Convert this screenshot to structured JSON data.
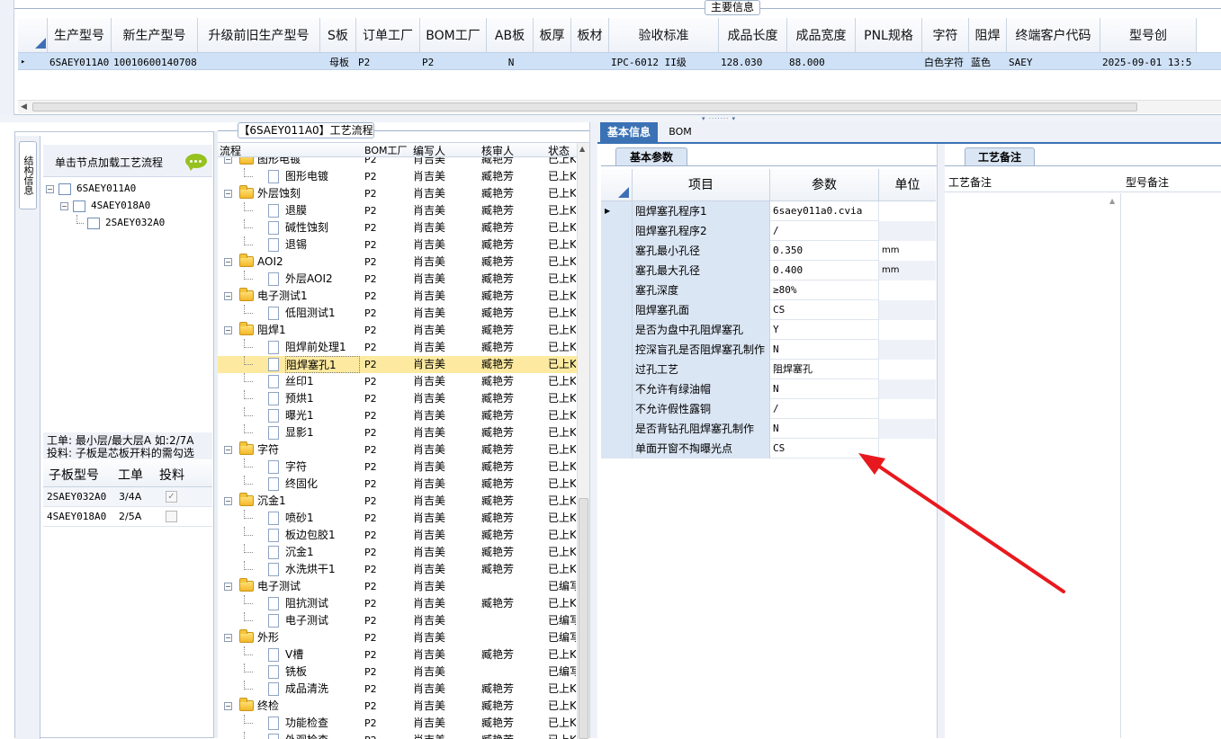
{
  "main_info": {
    "title": "主要信息",
    "columns": [
      "生产型号",
      "新生产型号",
      "升级前旧生产型号",
      "S板",
      "订单工厂",
      "BOM工厂",
      "AB板",
      "板厚",
      "板材",
      "验收标准",
      "成品长度",
      "成品宽度",
      "PNL规格",
      "字符",
      "阻焊",
      "终端客户代码",
      "型号创"
    ],
    "row": {
      "marker": "▸",
      "cells": [
        "6SAEY011A0",
        "10010600140708",
        "",
        "母板",
        "P2",
        "P2",
        "N",
        "",
        "",
        "IPC-6012 II级",
        "128.030",
        "88.000",
        "",
        "白色字符",
        "蓝色",
        "SAEY",
        "2025-09-01 13:5"
      ]
    }
  },
  "left_panel": {
    "vertical_tab": "结构信息",
    "hint": "单击节点加载工艺流程",
    "tree": [
      {
        "label": "6SAEY011A0",
        "depth": 0
      },
      {
        "label": "4SAEY018A0",
        "depth": 1
      },
      {
        "label": "2SAEY032A0",
        "depth": 2
      }
    ],
    "note1": "工单: 最小层/最大层A 如:2/7A",
    "note2": "投料: 子板是芯板开料的需勾选",
    "sub_table": {
      "headers": [
        "子板型号",
        "工单",
        "投料"
      ],
      "rows": [
        {
          "model": "2SAEY032A0",
          "order": "3/4A",
          "checked": true
        },
        {
          "model": "4SAEY018A0",
          "order": "2/5A",
          "checked": false
        }
      ]
    }
  },
  "process": {
    "title": "【6SAEY011A0】工艺流程",
    "headers": [
      "流程",
      "BOM工厂",
      "编写人",
      "核审人",
      "状态"
    ],
    "rows": [
      {
        "name": "图形电镀",
        "depth": 0,
        "folder": true,
        "bom": "P2",
        "writer": "肖吉美",
        "reviewer": "臧艳芳",
        "status": "已上KK"
      },
      {
        "name": "图形电镀",
        "depth": 1,
        "folder": false,
        "bom": "P2",
        "writer": "肖吉美",
        "reviewer": "臧艳芳",
        "status": "已上KK"
      },
      {
        "name": "外层蚀刻",
        "depth": 0,
        "folder": true,
        "bom": "P2",
        "writer": "肖吉美",
        "reviewer": "臧艳芳",
        "status": "已上KK"
      },
      {
        "name": "退膜",
        "depth": 1,
        "folder": false,
        "bom": "P2",
        "writer": "肖吉美",
        "reviewer": "臧艳芳",
        "status": "已上KK"
      },
      {
        "name": "碱性蚀刻",
        "depth": 1,
        "folder": false,
        "bom": "P2",
        "writer": "肖吉美",
        "reviewer": "臧艳芳",
        "status": "已上KK"
      },
      {
        "name": "退锡",
        "depth": 1,
        "folder": false,
        "bom": "P2",
        "writer": "肖吉美",
        "reviewer": "臧艳芳",
        "status": "已上KK"
      },
      {
        "name": "AOI2",
        "depth": 0,
        "folder": true,
        "bom": "P2",
        "writer": "肖吉美",
        "reviewer": "臧艳芳",
        "status": "已上KK"
      },
      {
        "name": "外层AOI2",
        "depth": 1,
        "folder": false,
        "bom": "P2",
        "writer": "肖吉美",
        "reviewer": "臧艳芳",
        "status": "已上KK"
      },
      {
        "name": "电子测试1",
        "depth": 0,
        "folder": true,
        "bom": "P2",
        "writer": "肖吉美",
        "reviewer": "臧艳芳",
        "status": "已上KK"
      },
      {
        "name": "低阻测试1",
        "depth": 1,
        "folder": false,
        "bom": "P2",
        "writer": "肖吉美",
        "reviewer": "臧艳芳",
        "status": "已上KK"
      },
      {
        "name": "阻焊1",
        "depth": 0,
        "folder": true,
        "bom": "P2",
        "writer": "肖吉美",
        "reviewer": "臧艳芳",
        "status": "已上KK"
      },
      {
        "name": "阻焊前处理1",
        "depth": 1,
        "folder": false,
        "bom": "P2",
        "writer": "肖吉美",
        "reviewer": "臧艳芳",
        "status": "已上KK"
      },
      {
        "name": "阻焊塞孔1",
        "depth": 1,
        "folder": false,
        "bom": "P2",
        "writer": "肖吉美",
        "reviewer": "臧艳芳",
        "status": "已上KK",
        "selected": true
      },
      {
        "name": "丝印1",
        "depth": 1,
        "folder": false,
        "bom": "P2",
        "writer": "肖吉美",
        "reviewer": "臧艳芳",
        "status": "已上KK"
      },
      {
        "name": "预烘1",
        "depth": 1,
        "folder": false,
        "bom": "P2",
        "writer": "肖吉美",
        "reviewer": "臧艳芳",
        "status": "已上KK"
      },
      {
        "name": "曝光1",
        "depth": 1,
        "folder": false,
        "bom": "P2",
        "writer": "肖吉美",
        "reviewer": "臧艳芳",
        "status": "已上KK"
      },
      {
        "name": "显影1",
        "depth": 1,
        "folder": false,
        "bom": "P2",
        "writer": "肖吉美",
        "reviewer": "臧艳芳",
        "status": "已上KK"
      },
      {
        "name": "字符",
        "depth": 0,
        "folder": true,
        "bom": "P2",
        "writer": "肖吉美",
        "reviewer": "臧艳芳",
        "status": "已上KK"
      },
      {
        "name": "字符",
        "depth": 1,
        "folder": false,
        "bom": "P2",
        "writer": "肖吉美",
        "reviewer": "臧艳芳",
        "status": "已上KK"
      },
      {
        "name": "终固化",
        "depth": 1,
        "folder": false,
        "bom": "P2",
        "writer": "肖吉美",
        "reviewer": "臧艳芳",
        "status": "已上KK"
      },
      {
        "name": "沉金1",
        "depth": 0,
        "folder": true,
        "bom": "P2",
        "writer": "肖吉美",
        "reviewer": "臧艳芳",
        "status": "已上KK"
      },
      {
        "name": "喷砂1",
        "depth": 1,
        "folder": false,
        "bom": "P2",
        "writer": "肖吉美",
        "reviewer": "臧艳芳",
        "status": "已上KK"
      },
      {
        "name": "板边包胶1",
        "depth": 1,
        "folder": false,
        "bom": "P2",
        "writer": "肖吉美",
        "reviewer": "臧艳芳",
        "status": "已上KK"
      },
      {
        "name": "沉金1",
        "depth": 1,
        "folder": false,
        "bom": "P2",
        "writer": "肖吉美",
        "reviewer": "臧艳芳",
        "status": "已上KK"
      },
      {
        "name": "水洗烘干1",
        "depth": 1,
        "folder": false,
        "bom": "P2",
        "writer": "肖吉美",
        "reviewer": "臧艳芳",
        "status": "已上KK"
      },
      {
        "name": "电子测试",
        "depth": 0,
        "folder": true,
        "bom": "P2",
        "writer": "肖吉美",
        "reviewer": "",
        "status": "已编写"
      },
      {
        "name": "阻抗测试",
        "depth": 1,
        "folder": false,
        "bom": "P2",
        "writer": "肖吉美",
        "reviewer": "臧艳芳",
        "status": "已上KK"
      },
      {
        "name": "电子测试",
        "depth": 1,
        "folder": false,
        "bom": "P2",
        "writer": "肖吉美",
        "reviewer": "",
        "status": "已编写"
      },
      {
        "name": "外形",
        "depth": 0,
        "folder": true,
        "bom": "P2",
        "writer": "肖吉美",
        "reviewer": "",
        "status": "已编写"
      },
      {
        "name": "V槽",
        "depth": 1,
        "folder": false,
        "bom": "P2",
        "writer": "肖吉美",
        "reviewer": "臧艳芳",
        "status": "已上KK"
      },
      {
        "name": "铣板",
        "depth": 1,
        "folder": false,
        "bom": "P2",
        "writer": "肖吉美",
        "reviewer": "",
        "status": "已编写"
      },
      {
        "name": "成品清洗",
        "depth": 1,
        "folder": false,
        "bom": "P2",
        "writer": "肖吉美",
        "reviewer": "臧艳芳",
        "status": "已上KK"
      },
      {
        "name": "终检",
        "depth": 0,
        "folder": true,
        "bom": "P2",
        "writer": "肖吉美",
        "reviewer": "臧艳芳",
        "status": "已上KK"
      },
      {
        "name": "功能检查",
        "depth": 1,
        "folder": false,
        "bom": "P2",
        "writer": "肖吉美",
        "reviewer": "臧艳芳",
        "status": "已上KK"
      },
      {
        "name": "外观检查",
        "depth": 1,
        "folder": false,
        "bom": "P2",
        "writer": "肖吉美",
        "reviewer": "臧艳芳",
        "status": "已上KK"
      }
    ]
  },
  "right_tabs": [
    "基本信息",
    "BOM"
  ],
  "params": {
    "tab": "基本参数",
    "headers": [
      "项目",
      "参数",
      "单位"
    ],
    "rows": [
      {
        "item": "阻焊塞孔程序1",
        "value": "6saey011a0.cvia",
        "unit": "",
        "current": true
      },
      {
        "item": "阻焊塞孔程序2",
        "value": "/",
        "unit": ""
      },
      {
        "item": "塞孔最小孔径",
        "value": "0.350",
        "unit": "mm"
      },
      {
        "item": "塞孔最大孔径",
        "value": "0.400",
        "unit": "mm"
      },
      {
        "item": "塞孔深度",
        "value": "≥80%",
        "unit": ""
      },
      {
        "item": "阻焊塞孔面",
        "value": "CS",
        "unit": ""
      },
      {
        "item": "是否为盘中孔阻焊塞孔",
        "value": "Y",
        "unit": ""
      },
      {
        "item": "控深盲孔是否阻焊塞孔制作",
        "value": "N",
        "unit": ""
      },
      {
        "item": "过孔工艺",
        "value": "阻焊塞孔",
        "unit": ""
      },
      {
        "item": "不允许有绿油帽",
        "value": "N",
        "unit": ""
      },
      {
        "item": "不允许假性露铜",
        "value": "/",
        "unit": ""
      },
      {
        "item": "是否背钻孔阻焊塞孔制作",
        "value": "N",
        "unit": ""
      },
      {
        "item": "单面开窗不掏曝光点",
        "value": "CS",
        "unit": ""
      }
    ]
  },
  "remarks": {
    "tab": "工艺备注",
    "col1": "工艺备注",
    "col2": "型号备注"
  },
  "colors": {
    "selection": "#fdeaa0",
    "header_blue": "#3b72b5",
    "arrow": "#e8191e"
  }
}
